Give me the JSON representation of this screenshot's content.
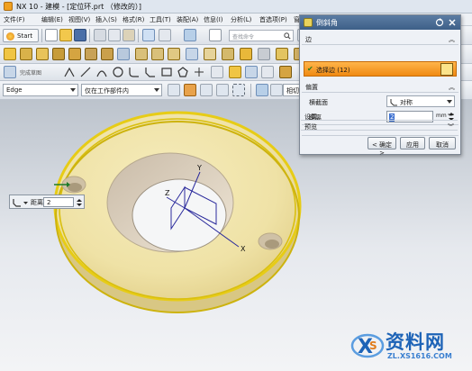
{
  "window": {
    "title": "NX 10 - 建模 - [定位环.prt （修改的）]"
  },
  "menu": {
    "items": [
      "文件(F)",
      "编辑(E)",
      "视图(V)",
      "插入(S)",
      "格式(R)",
      "工具(T)",
      "装配(A)",
      "信息(I)",
      "分析(L)",
      "首选项(P)",
      "窗"
    ]
  },
  "toolbar": {
    "start_label": "Start",
    "search_placeholder": "查找命令",
    "hole_label": "孔",
    "face_blend_label": "面倒圆",
    "fulltext_label": "完成草图"
  },
  "selection_bar": {
    "filter_value": "Edge",
    "scope_value": "仅在工作部件内",
    "snap_label": "相切"
  },
  "onscreen_input": {
    "label": "距离",
    "value": "2"
  },
  "dialog": {
    "title": "倒斜角",
    "sections": {
      "edge": "边",
      "offset": "偏置",
      "settings": "设置",
      "preview": "预览"
    },
    "select_edge_label": "选择边 (12)",
    "cross_section_label": "横截面",
    "cross_section_value": "对称",
    "distance_label": "距离",
    "distance_value": "2",
    "distance_unit": "mm",
    "buttons": {
      "ok": "< 确定 >",
      "apply": "应用",
      "cancel": "取消"
    }
  },
  "viewport": {
    "axis_x": "X",
    "axis_y": "Y",
    "axis_z": "Z",
    "part_color": "#efe2a6",
    "edge_color": "#e7cc16",
    "bore_color": "#d9cfc0"
  },
  "watermark": {
    "text": "资料网",
    "url": "ZL.XS1616.COM"
  }
}
